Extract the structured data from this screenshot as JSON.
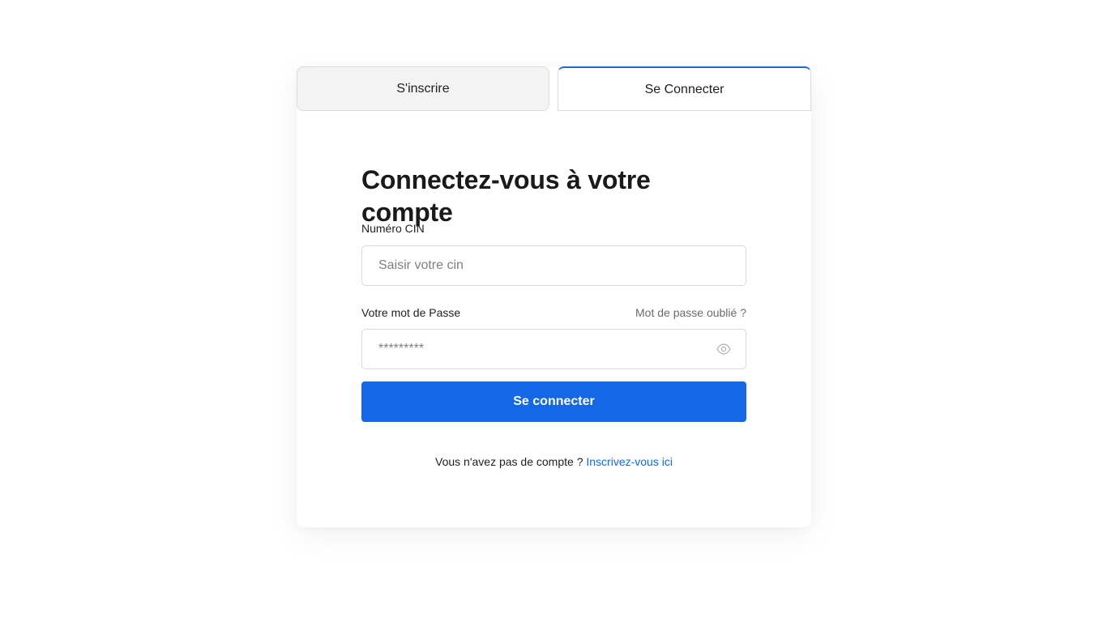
{
  "tabs": {
    "register_label": "S'inscrire",
    "login_label": "Se Connecter"
  },
  "form": {
    "title": "Connectez-vous à votre compte",
    "cin": {
      "label": "Numéro CIN",
      "placeholder": "Saisir votre cin",
      "value": ""
    },
    "password": {
      "label": "Votre mot de Passe",
      "placeholder": "*********",
      "value": ""
    },
    "forgot_label": "Mot de passe oublié ?",
    "submit_label": "Se connecter",
    "no_account_text": "Vous n'avez pas de compte ?",
    "register_link_label": "Inscrivez-vous ici"
  },
  "icons": {
    "password_toggle": "eye-icon"
  },
  "colors": {
    "accent": "#1467e6",
    "inactive_tab_bg": "#f3f3f3",
    "text": "#1a1a1a",
    "muted": "#6b6b6b"
  }
}
